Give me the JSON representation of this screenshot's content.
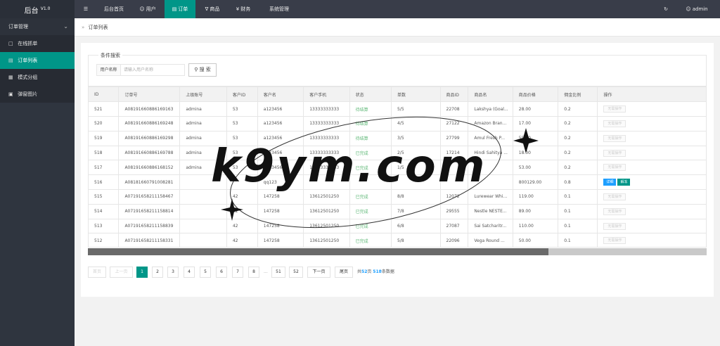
{
  "app": {
    "title": "后台",
    "version": "V1.0"
  },
  "sidebar": {
    "group": "订单管理",
    "items": [
      {
        "label": "在线抓单",
        "icon": "document-icon",
        "active": false
      },
      {
        "label": "订单列表",
        "icon": "list-icon",
        "active": true
      },
      {
        "label": "模式分组",
        "icon": "group-icon",
        "active": false
      },
      {
        "label": "弹窗图片",
        "icon": "image-icon",
        "active": false
      }
    ]
  },
  "topnav": {
    "menu_icon": "☰",
    "items": [
      {
        "label": "后台首页",
        "icon": ""
      },
      {
        "label": "用户",
        "icon": "user-icon"
      },
      {
        "label": "订单",
        "icon": "order-icon",
        "active": true
      },
      {
        "label": "商品",
        "icon": "cart-icon"
      },
      {
        "label": "财务",
        "icon": "yen-icon"
      },
      {
        "label": "系统管理",
        "icon": ""
      }
    ],
    "refresh_icon": "refresh-icon",
    "user": "admin"
  },
  "breadcrumb": {
    "current": "订单列表"
  },
  "search": {
    "legend": "条件搜索",
    "label": "用户名称",
    "placeholder": "请输入用户名称",
    "button": "搜 索"
  },
  "table": {
    "columns": [
      "ID",
      "订单号",
      "上级账号",
      "客户ID",
      "客户名",
      "客户手机",
      "状态",
      "单数",
      "商品ID",
      "商品名",
      "商品价格",
      "佣金比例",
      "操作"
    ],
    "rows": [
      {
        "id": "521",
        "order_no": "A08191660886169163",
        "parent": "admina",
        "cust_id": "53",
        "cust_name": "a123456",
        "phone": "13333333333",
        "status": "待结算",
        "count": "5/5",
        "goods_id": "22708",
        "goods_name": "Lakshya (Goal...",
        "price": "28.00",
        "rate": "0.2",
        "ops": [
          "无需操作"
        ]
      },
      {
        "id": "520",
        "order_no": "A08191660886169248",
        "parent": "admina",
        "cust_id": "53",
        "cust_name": "a123456",
        "phone": "13333333333",
        "status": "待结算",
        "count": "4/5",
        "goods_id": "27122",
        "goods_name": "Amazon Bran...",
        "price": "17.00",
        "rate": "0.2",
        "ops": [
          "无需操作"
        ]
      },
      {
        "id": "519",
        "order_no": "A08191660886169298",
        "parent": "admina",
        "cust_id": "53",
        "cust_name": "a123456",
        "phone": "13333333333",
        "status": "待结算",
        "count": "3/5",
        "goods_id": "27799",
        "goods_name": "Amul Fresh P...",
        "price": "55.00",
        "rate": "0.2",
        "ops": [
          "无需操作"
        ]
      },
      {
        "id": "518",
        "order_no": "A08191660886169788",
        "parent": "admina",
        "cust_id": "53",
        "cust_name": "a123456",
        "phone": "13333333333",
        "status": "已完成",
        "count": "2/5",
        "goods_id": "17214",
        "goods_name": "Hindi Sahitya ...",
        "price": "18.00",
        "rate": "0.2",
        "ops": [
          "无需操作"
        ]
      },
      {
        "id": "517",
        "order_no": "A08191660886168152",
        "parent": "admina",
        "cust_id": "53",
        "cust_name": "a123456",
        "phone": "13333333333",
        "status": "已完成",
        "count": "1/5",
        "goods_id": "",
        "goods_name": "",
        "price": "53.00",
        "rate": "0.2",
        "ops": [
          "无需操作"
        ]
      },
      {
        "id": "516",
        "order_no": "A08181660791008281",
        "parent": "",
        "cust_id": "",
        "cust_name": "qq123",
        "phone": "",
        "status": "",
        "count": "",
        "goods_id": "",
        "goods_name": "",
        "price": "800129.00",
        "rate": "0.8",
        "ops": [
          "详细",
          "解冻"
        ]
      },
      {
        "id": "515",
        "order_no": "A07191658211158467",
        "parent": "",
        "cust_id": "42",
        "cust_name": "147258",
        "phone": "13612501250",
        "status": "已完成",
        "count": "8/8",
        "goods_id": "12072",
        "goods_name": "Lurewear Whi...",
        "price": "119.00",
        "rate": "0.1",
        "ops": [
          "无需操作"
        ]
      },
      {
        "id": "514",
        "order_no": "A07191658211158814",
        "parent": "",
        "cust_id": "42",
        "cust_name": "147258",
        "phone": "13612501250",
        "status": "已完成",
        "count": "7/8",
        "goods_id": "29555",
        "goods_name": "Nestle NESTE...",
        "price": "89.00",
        "rate": "0.1",
        "ops": [
          "无需操作"
        ]
      },
      {
        "id": "513",
        "order_no": "A07191658211158839",
        "parent": "",
        "cust_id": "42",
        "cust_name": "147258",
        "phone": "13612501250",
        "status": "已完成",
        "count": "6/8",
        "goods_id": "27087",
        "goods_name": "Sai Satcharitr...",
        "price": "110.00",
        "rate": "0.1",
        "ops": [
          "无需操作"
        ]
      },
      {
        "id": "512",
        "order_no": "A07191658211158331",
        "parent": "",
        "cust_id": "42",
        "cust_name": "147258",
        "phone": "13612501250",
        "status": "已完成",
        "count": "5/8",
        "goods_id": "22096",
        "goods_name": "Vega Round ...",
        "price": "50.00",
        "rate": "0.1",
        "ops": [
          "无需操作"
        ]
      }
    ]
  },
  "pager": {
    "first": "首页",
    "prev": "上一页",
    "pages": [
      "1",
      "2",
      "3",
      "4",
      "5",
      "6",
      "7",
      "8"
    ],
    "current": "1",
    "ellipsis": "...",
    "tail_pages": [
      "51",
      "52"
    ],
    "next": "下一页",
    "last": "尾页",
    "total_prefix": "共",
    "total_pages": "52",
    "total_mid": "页 ",
    "total_count": "518",
    "total_suffix": "条数据"
  },
  "watermark": "k9ym.com",
  "colors": {
    "accent": "#009688",
    "sidebar": "#2f353f",
    "topbar": "#393d49",
    "link": "#1e9fff",
    "status_green": "#5fb878"
  }
}
